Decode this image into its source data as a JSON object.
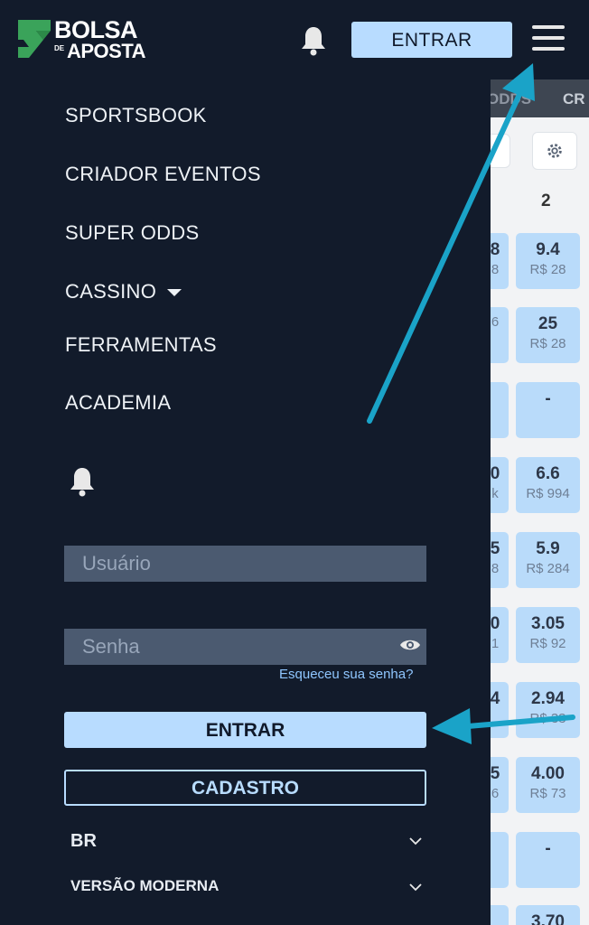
{
  "header": {
    "logo_line1": "BOLSA",
    "logo_de": "DE",
    "logo_line2": "APOSTA",
    "entrar_label": "ENTRAR",
    "bell_icon": "bell-icon",
    "menu_icon": "hamburger-menu-icon"
  },
  "background": {
    "tab_odds": "ODDS",
    "tab_cr": "CR",
    "column_header": "2",
    "rows": [
      {
        "left_odd": "8",
        "left_vol": "8",
        "odd": "9.4",
        "vol": "R$ 28"
      },
      {
        "left_odd": "",
        "left_vol": "6",
        "odd": "25",
        "vol": "R$ 28"
      },
      {
        "left_odd": "",
        "left_vol": "",
        "odd": "-",
        "vol": ""
      },
      {
        "left_odd": "0",
        "left_vol": "k",
        "odd": "6.6",
        "vol": "R$ 994"
      },
      {
        "left_odd": "5",
        "left_vol": "8",
        "odd": "5.9",
        "vol": "R$ 284"
      },
      {
        "left_odd": "0",
        "left_vol": "1",
        "odd": "3.05",
        "vol": "R$ 92"
      },
      {
        "left_odd": "4",
        "left_vol": "",
        "odd": "2.94",
        "vol": "R$ 33"
      },
      {
        "left_odd": "5",
        "left_vol": "6",
        "odd": "4.00",
        "vol": "R$ 73"
      },
      {
        "left_odd": "",
        "left_vol": "",
        "odd": "-",
        "vol": ""
      },
      {
        "left_odd": "",
        "left_vol": "",
        "odd": "3.70",
        "vol": ""
      }
    ]
  },
  "drawer": {
    "menu": [
      "SPORTSBOOK",
      "CRIADOR EVENTOS",
      "SUPER ODDS",
      "CASSINO",
      "FERRAMENTAS",
      "ACADEMIA"
    ],
    "username_placeholder": "Usuário",
    "password_placeholder": "Senha",
    "forgot_password": "Esqueceu sua senha?",
    "entrar_label": "ENTRAR",
    "cadastro_label": "CADASTRO",
    "language": "BR",
    "version": "VERSÃO MODERNA"
  },
  "colors": {
    "background": "#121b2b",
    "accent": "#b8dcff",
    "annotation_arrow": "#1aa3c8",
    "logo_green": "#3aa35a"
  }
}
